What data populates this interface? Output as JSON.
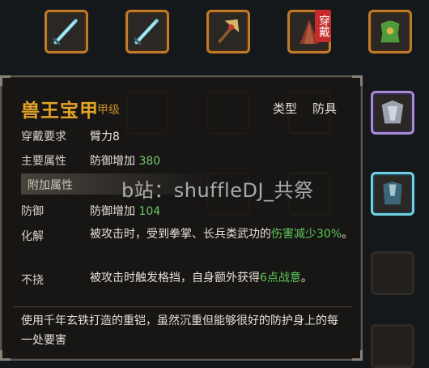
{
  "inventory": {
    "top_row": [
      {
        "name": "sword-1",
        "border": "orange"
      },
      {
        "name": "sword-2",
        "border": "orange"
      },
      {
        "name": "axe",
        "border": "orange"
      },
      {
        "name": "cloak",
        "border": "orange",
        "badge": "穿戴"
      },
      {
        "name": "armor-green",
        "border": "orange"
      }
    ],
    "right_column": [
      {
        "name": "silk-garment",
        "border": "purple"
      },
      {
        "name": "blue-robe",
        "border": "cyan"
      }
    ]
  },
  "tooltip": {
    "name": "兽王宝甲",
    "grade": "甲级",
    "type_label": "类型",
    "type_value": "防具",
    "requirement_label": "穿戴要求",
    "requirement_value": "臂力8",
    "main_attr_label": "主要属性",
    "main_attr_text": "防御增加",
    "main_attr_value": "380",
    "extra_attr_header": "附加属性",
    "defense_label": "防御",
    "defense_text": "防御增加",
    "defense_value": "104",
    "effect1_label": "化解",
    "effect1_text_a": "被攻击时，受到拳掌、长兵类武功的",
    "effect1_highlight": "伤害减少30%",
    "effect1_text_b": "。",
    "effect2_label": "不挠",
    "effect2_text_a": "被攻击时触发格挡，自身额外获得",
    "effect2_highlight": "6点战意",
    "effect2_text_b": "。",
    "description": "使用千年玄铁打造的重铠，虽然沉重但能够很好的防护身上的每一处要害"
  },
  "watermark": "b站：shuffleDJ_共祭",
  "colors": {
    "title": "#e4a427",
    "highlight": "#5ec85a",
    "number": "#6fc868",
    "border_orange": "#c07a2a",
    "border_purple": "#a88ad6",
    "border_cyan": "#6fd2e4"
  }
}
